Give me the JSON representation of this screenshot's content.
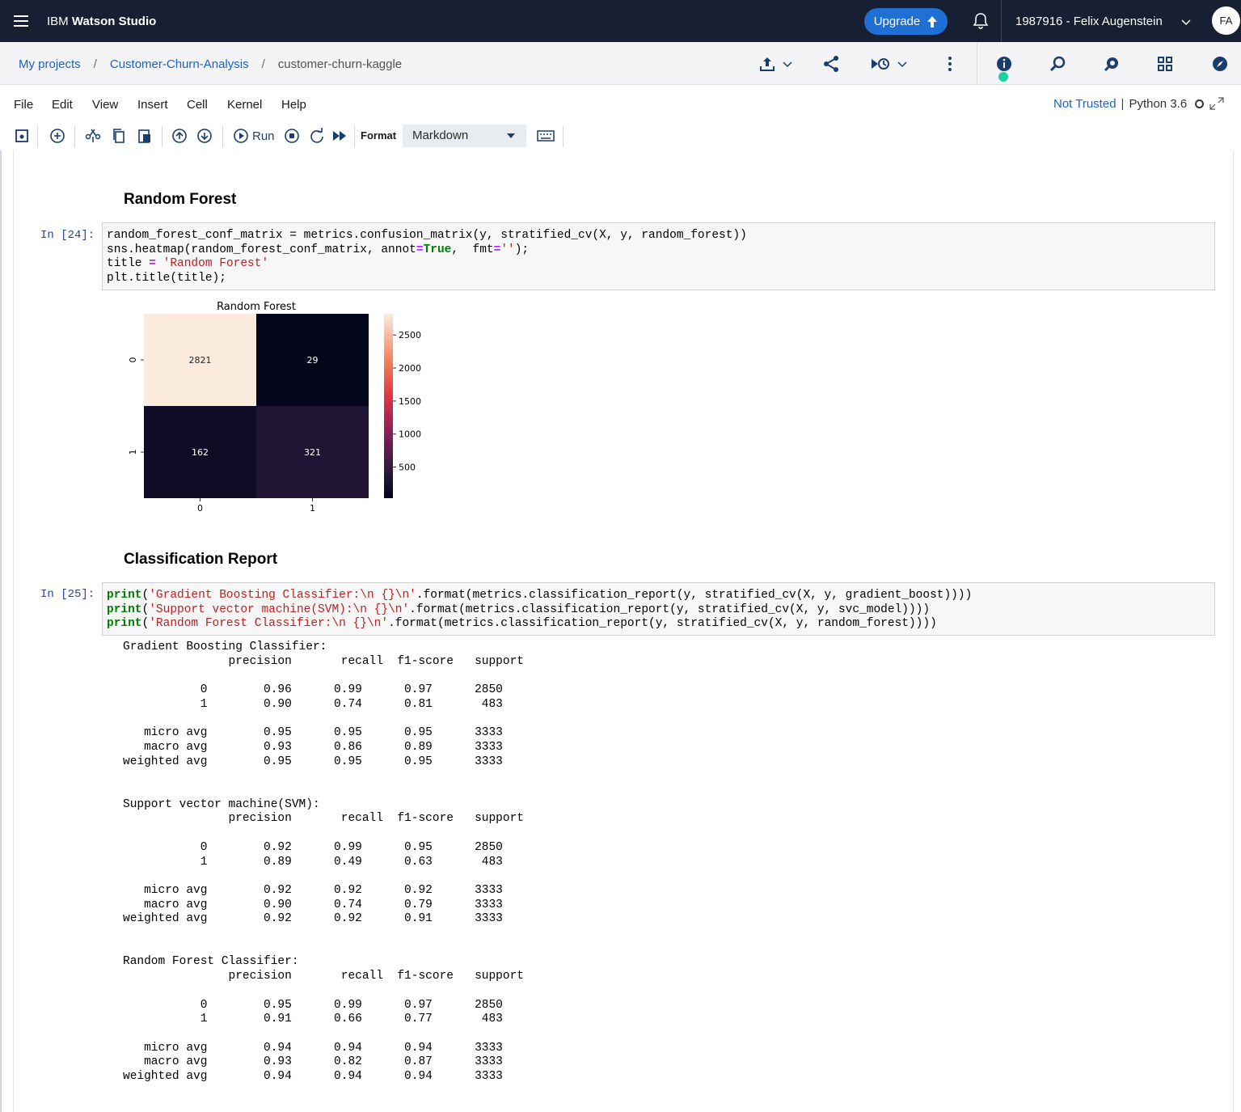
{
  "header": {
    "brand_prefix": "IBM",
    "brand_name": "Watson Studio",
    "upgrade_label": "Upgrade",
    "account_label": "1987916 - Felix Augenstein",
    "avatar_initials": "FA"
  },
  "breadcrumb": {
    "items": [
      "My projects",
      "Customer-Churn-Analysis"
    ],
    "separator": "/",
    "current": "customer-churn-kaggle"
  },
  "menu": {
    "items": [
      "File",
      "Edit",
      "View",
      "Insert",
      "Cell",
      "Kernel",
      "Help"
    ]
  },
  "kernel": {
    "trust": "Not Trusted",
    "name": "Python 3.6"
  },
  "toolbar": {
    "run_label": "Run",
    "format_label": "Format",
    "format_value": "Markdown"
  },
  "cells": {
    "heading_random_forest": "Random Forest",
    "prompt_24": "In [24]:",
    "heading_classification": "Classification Report",
    "prompt_25": "In [25]:"
  },
  "code_24": [
    "random_forest_conf_matrix = metrics.confusion_matrix(y, stratified_cv(X, y, random_forest))",
    "sns.heatmap(random_forest_conf_matrix, annot=True,  fmt='');",
    "title = 'Random Forest'",
    "plt.title(title);"
  ],
  "code_25": [
    "print('Gradient Boosting Classifier:\\n {}\\n'.format(metrics.classification_report(y, stratified_cv(X, y, gradient_boost))))",
    "print('Support vector machine(SVM):\\n {}\\n'.format(metrics.classification_report(y, stratified_cv(X, y, svc_model))))",
    "print('Random Forest Classifier:\\n {}\\n'.format(metrics.classification_report(y, stratified_cv(X, y, random_forest))))"
  ],
  "chart_data": {
    "type": "heatmap",
    "title": "Random Forest",
    "x_categories": [
      "0",
      "1"
    ],
    "y_categories": [
      "0",
      "1"
    ],
    "values": [
      [
        2821,
        29
      ],
      [
        162,
        321
      ]
    ],
    "colorbar_ticks": [
      2500,
      2000,
      1500,
      1000,
      500
    ],
    "colorbar_range": [
      29,
      2821
    ],
    "colormap": "rocket"
  },
  "reports": [
    {
      "title": "Gradient Boosting Classifier:",
      "header": [
        "precision",
        "recall",
        "f1-score",
        "support"
      ],
      "rows": [
        [
          "0",
          "0.96",
          "0.99",
          "0.97",
          "2850"
        ],
        [
          "1",
          "0.90",
          "0.74",
          "0.81",
          "483"
        ]
      ],
      "avgs": [
        [
          "micro avg",
          "0.95",
          "0.95",
          "0.95",
          "3333"
        ],
        [
          "macro avg",
          "0.93",
          "0.86",
          "0.89",
          "3333"
        ],
        [
          "weighted avg",
          "0.95",
          "0.95",
          "0.95",
          "3333"
        ]
      ]
    },
    {
      "title": "Support vector machine(SVM):",
      "header": [
        "precision",
        "recall",
        "f1-score",
        "support"
      ],
      "rows": [
        [
          "0",
          "0.92",
          "0.99",
          "0.95",
          "2850"
        ],
        [
          "1",
          "0.89",
          "0.49",
          "0.63",
          "483"
        ]
      ],
      "avgs": [
        [
          "micro avg",
          "0.92",
          "0.92",
          "0.92",
          "3333"
        ],
        [
          "macro avg",
          "0.90",
          "0.74",
          "0.79",
          "3333"
        ],
        [
          "weighted avg",
          "0.92",
          "0.92",
          "0.91",
          "3333"
        ]
      ]
    },
    {
      "title": "Random Forest Classifier:",
      "header": [
        "precision",
        "recall",
        "f1-score",
        "support"
      ],
      "rows": [
        [
          "0",
          "0.95",
          "0.99",
          "0.97",
          "2850"
        ],
        [
          "1",
          "0.91",
          "0.66",
          "0.77",
          "483"
        ]
      ],
      "avgs": [
        [
          "micro avg",
          "0.94",
          "0.94",
          "0.94",
          "3333"
        ],
        [
          "macro avg",
          "0.93",
          "0.82",
          "0.87",
          "3333"
        ],
        [
          "weighted avg",
          "0.94",
          "0.94",
          "0.94",
          "3333"
        ]
      ]
    }
  ]
}
